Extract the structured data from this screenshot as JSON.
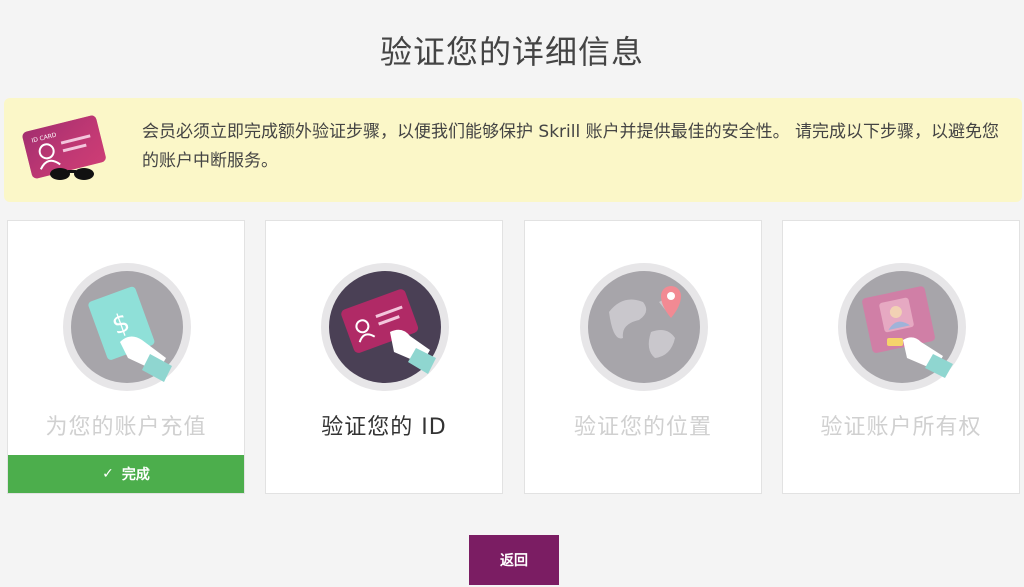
{
  "page": {
    "title": "验证您的详细信息"
  },
  "notice": {
    "text": "会员必须立即完成额外验证步骤，以便我们能够保护 Skrill 账户并提供最佳的安全性。 请完成以下步骤，以避免您的账户中断服务。"
  },
  "steps": [
    {
      "label": "为您的账户充值",
      "status": "完成",
      "icon": "money-hand-icon"
    },
    {
      "label": "验证您的 ID",
      "icon": "id-card-hand-icon"
    },
    {
      "label": "验证您的位置",
      "icon": "globe-location-icon"
    },
    {
      "label": "验证账户所有权",
      "icon": "photo-card-hand-icon"
    }
  ],
  "actions": {
    "back_label": "返回"
  },
  "colors": {
    "success": "#4cae4c",
    "brand": "#7b1d63",
    "notice_bg": "#fbf7c8"
  }
}
